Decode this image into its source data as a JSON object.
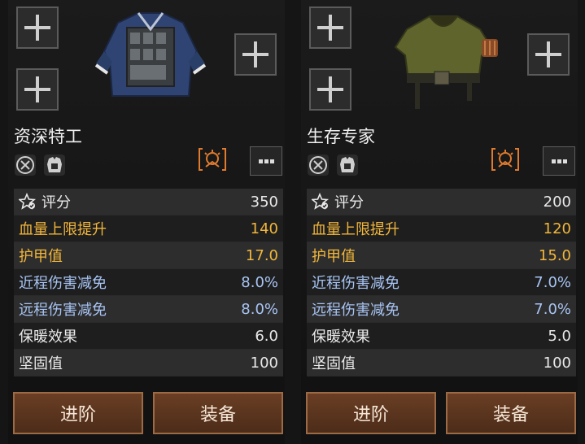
{
  "panels": [
    {
      "name": "资深特工",
      "stats": [
        {
          "label": "评分",
          "value": "350",
          "style": "white",
          "icon": "score-icon"
        },
        {
          "label": "血量上限提升",
          "value": "140",
          "style": "gold"
        },
        {
          "label": "护甲值",
          "value": "17.0",
          "style": "gold"
        },
        {
          "label": "近程伤害减免",
          "value": "8.0%",
          "style": "blue"
        },
        {
          "label": "远程伤害减免",
          "value": "8.0%",
          "style": "blue"
        },
        {
          "label": "保暖效果",
          "value": "6.0",
          "style": "white"
        },
        {
          "label": "坚固值",
          "value": "100",
          "style": "white"
        }
      ],
      "buttons": {
        "upgrade": "进阶",
        "equip": "装备"
      }
    },
    {
      "name": "生存专家",
      "stats": [
        {
          "label": "评分",
          "value": "200",
          "style": "white",
          "icon": "score-icon"
        },
        {
          "label": "血量上限提升",
          "value": "120",
          "style": "gold"
        },
        {
          "label": "护甲值",
          "value": "15.0",
          "style": "gold"
        },
        {
          "label": "近程伤害减免",
          "value": "7.0%",
          "style": "blue"
        },
        {
          "label": "远程伤害减免",
          "value": "7.0%",
          "style": "blue"
        },
        {
          "label": "保暖效果",
          "value": "5.0",
          "style": "white"
        },
        {
          "label": "坚固值",
          "value": "100",
          "style": "white"
        }
      ],
      "buttons": {
        "upgrade": "进阶",
        "equip": "装备"
      }
    }
  ],
  "icons": [
    "plus-icon",
    "armor-vest-icon",
    "durability-icon",
    "chest-armor-icon",
    "rank-badge-icon",
    "more-options-icon",
    "score-icon"
  ]
}
